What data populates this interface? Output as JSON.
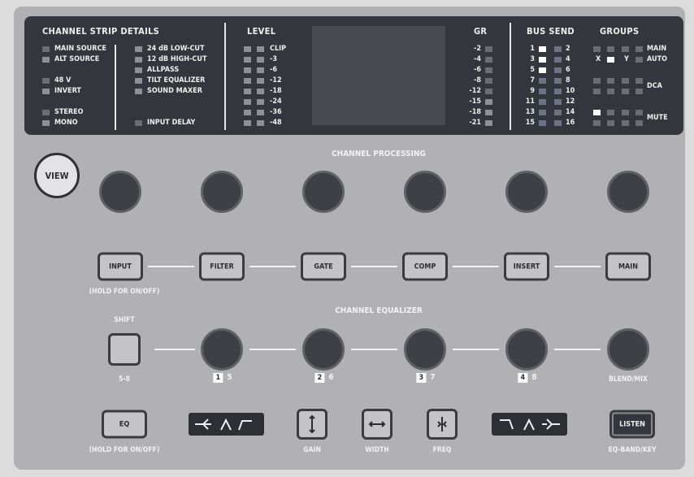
{
  "strip": {
    "title": "CHANNEL STRIP DETAILS",
    "left": [
      "MAIN SOURCE",
      "ALT SOURCE",
      "48 V",
      "INVERT",
      "STEREO",
      "MONO"
    ],
    "right": [
      "24 dB LOW-CUT",
      "12 dB HIGH-CUT",
      "ALLPASS",
      "TILT EQUALIZER",
      "SOUND MAXER",
      "INPUT DELAY"
    ]
  },
  "level": {
    "title": "LEVEL",
    "labels": [
      "CLIP",
      "-3",
      "-6",
      "-12",
      "-18",
      "-24",
      "-36",
      "-48"
    ]
  },
  "gr": {
    "title": "GR",
    "labels": [
      "-2",
      "-4",
      "-6",
      "-8",
      "-12",
      "-15",
      "-18",
      "-21"
    ]
  },
  "bus": {
    "title": "BUS SEND",
    "odd": [
      "1",
      "3",
      "5",
      "7",
      "9",
      "11",
      "13",
      "15"
    ],
    "even": [
      "2",
      "4",
      "6",
      "8",
      "10",
      "12",
      "14",
      "16"
    ],
    "active": [
      "1",
      "3",
      "5"
    ]
  },
  "groups": {
    "title": "GROUPS",
    "main": "MAIN",
    "auto": "AUTO",
    "x": "X",
    "y": "Y",
    "dca": "DCA",
    "mute": "MUTE"
  },
  "view": "VIEW",
  "processing": {
    "title": "CHANNEL PROCESSING",
    "buttons": [
      "INPUT",
      "FILTER",
      "GATE",
      "COMP",
      "INSERT",
      "MAIN"
    ],
    "hint": "(HOLD FOR ON/OFF)"
  },
  "eq": {
    "title": "CHANNEL EQUALIZER",
    "shift": "SHIFT",
    "shift_sub": "5-8",
    "bands": [
      {
        "n": "1",
        "alt": "5"
      },
      {
        "n": "2",
        "alt": "6"
      },
      {
        "n": "3",
        "alt": "7"
      },
      {
        "n": "4",
        "alt": "8"
      }
    ],
    "blend": "BLEND/MIX"
  },
  "bottom": {
    "eq": "EQ",
    "eq_hint": "(HOLD FOR ON/OFF)",
    "gain": "GAIN",
    "width": "WIDTH",
    "freq": "FREQ",
    "listen": "LISTEN",
    "listen_hint": "EQ-BAND/KEY"
  }
}
